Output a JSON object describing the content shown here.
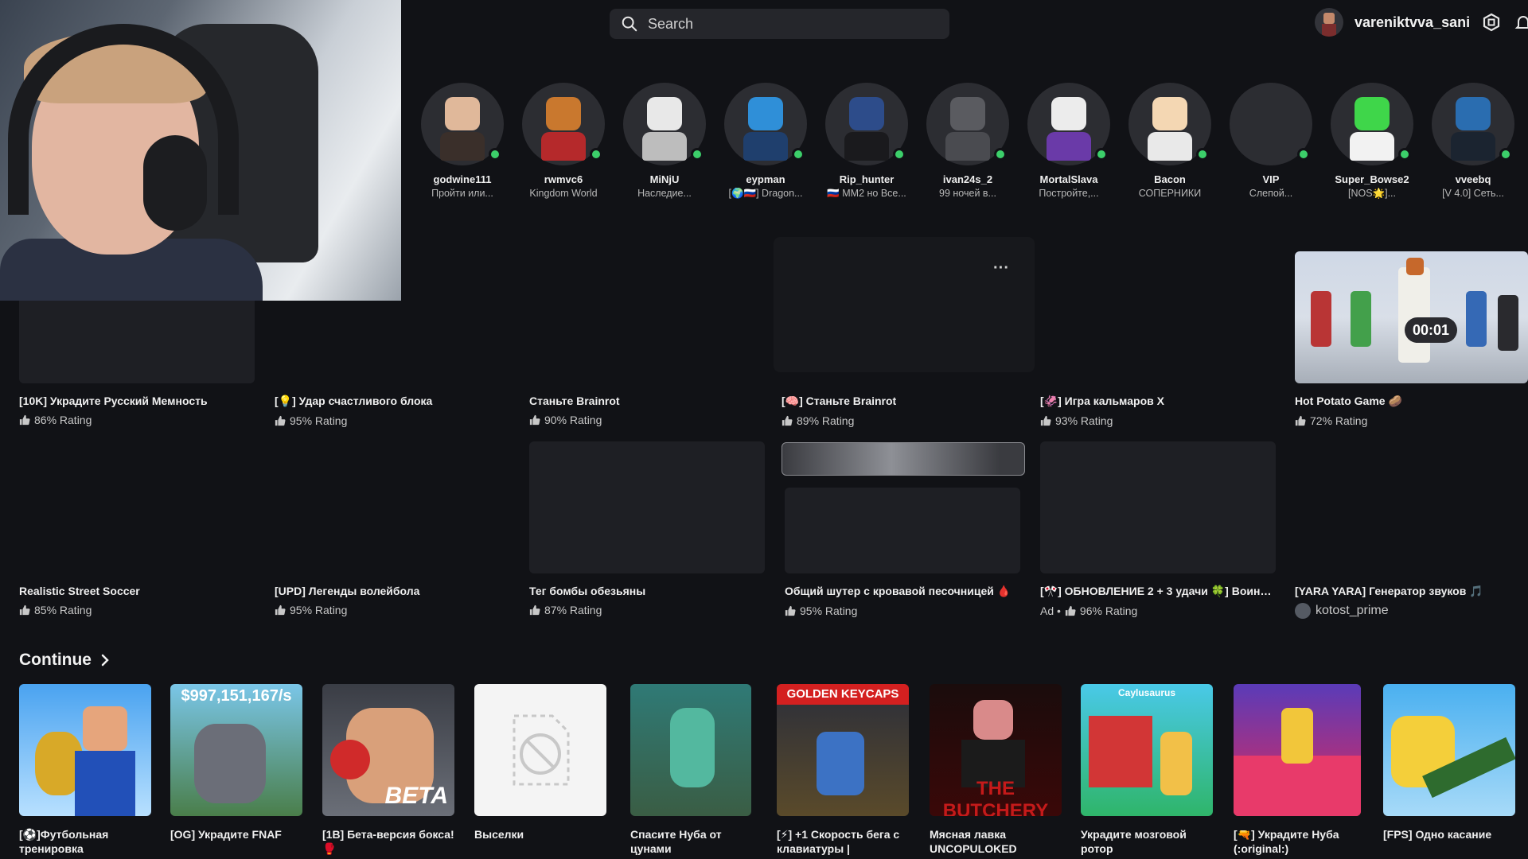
{
  "search": {
    "placeholder": "Search"
  },
  "user": {
    "name": "vareniktvva_sani"
  },
  "friends": [
    {
      "name": "godwine111",
      "status": "Пройти или..."
    },
    {
      "name": "rwmvc6",
      "status": "Kingdom World"
    },
    {
      "name": "MiNjU",
      "status": "Наследие..."
    },
    {
      "name": "eypman",
      "status": "[🌍🇷🇺] Dragon..."
    },
    {
      "name": "Rip_hunter",
      "status": "🇷🇺 MM2 но Все..."
    },
    {
      "name": "ivan24s_2",
      "status": "99 ночей в..."
    },
    {
      "name": "MortalSlava",
      "status": "Постройте,..."
    },
    {
      "name": "Bacon",
      "status": "СОПЕРНИКИ"
    },
    {
      "name": "VIP",
      "status": "Слепой..."
    },
    {
      "name": "Super_Bowse2",
      "status": "[NOS🌟]..."
    },
    {
      "name": "vveebq",
      "status": "[V 4.0] Сеть..."
    }
  ],
  "games_row1": [
    {
      "title": "[10K] Украдите Русский Мемность",
      "rating": "86% Rating"
    },
    {
      "title": "[💡] Удар счастливого блока",
      "rating": "95% Rating"
    },
    {
      "title": "Станьте Brainrot",
      "rating": "90% Rating"
    },
    {
      "title": "[🧠] Станьте Brainrot",
      "rating": "89% Rating"
    },
    {
      "title": "[🦑] Игра кальмаров X",
      "rating": "93% Rating"
    },
    {
      "title": "Hot Potato Game 🥔",
      "rating": "72% Rating"
    }
  ],
  "games_row2": [
    {
      "title": "Realistic Street Soccer",
      "rating": "85% Rating"
    },
    {
      "title": "[UPD] Легенды волейбола",
      "rating": "95% Rating"
    },
    {
      "title": "Тег бомбы обезьяны",
      "rating": "87% Rating"
    },
    {
      "title": "Общий шутер с кровавой песочницей 🩸",
      "rating": "95% Rating"
    },
    {
      "title": "[🎌] ОБНОВЛЕНИЕ 2 + 3 удачи 🍀] Воины ...",
      "rating": "96% Rating",
      "ad": "Ad •"
    },
    {
      "title": "[YARA YARA] Генератор звуков 🎵",
      "creator": "kotost_prime"
    }
  ],
  "hot_potato_timer": "00:01",
  "more_label": "···",
  "continue": {
    "label": "Continue",
    "items": [
      {
        "title": "[⚽]Футбольная тренировка"
      },
      {
        "title": "[OG] Украдите FNAF",
        "overlay": "$997,151,167/s"
      },
      {
        "title": "[1B] Бета-версия бокса! 🥊",
        "overlay": "BETA"
      },
      {
        "title": "Выселки"
      },
      {
        "title": "Спасите Нуба от цунами"
      },
      {
        "title": "[⚡] +1 Скорость бега с клавиатуры |",
        "overlay": "GOLDEN KEYCAPS"
      },
      {
        "title": "Мясная лавка UNCOPULOKED",
        "overlay": "THE BUTCHERY"
      },
      {
        "title": "Украдите мозговой ротор",
        "overlay": "Caylusaurus"
      },
      {
        "title": "[🔫] Украдите Нуба (:original:)"
      },
      {
        "title": "[FPS] Одно касание"
      }
    ]
  },
  "colors": {
    "online": "#3ccf6a",
    "background": "#111216"
  }
}
